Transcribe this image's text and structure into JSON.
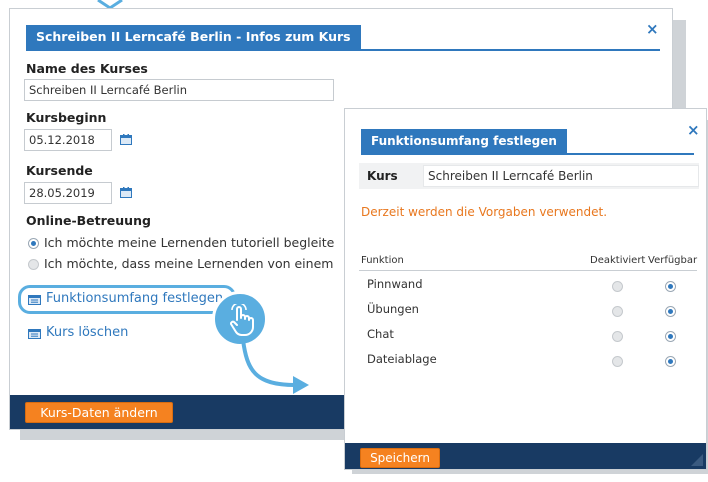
{
  "dialog1": {
    "title": "Schreiben II Lerncafé Berlin - Infos zum Kurs",
    "close_label": "×",
    "course_name_label": "Name des Kurses",
    "course_name_value": "Schreiben II Lerncafé Berlin",
    "start_label": "Kursbeginn",
    "start_value": "05.12.2018",
    "end_label": "Kursende",
    "end_value": "28.05.2019",
    "online_label": "Online-Betreuung",
    "options": [
      {
        "label": "Ich möchte meine Lernenden tutoriell begleite",
        "selected": true
      },
      {
        "label": "Ich möchte, dass meine Lernenden von einem",
        "selected": false
      }
    ],
    "function_link": "Funktionsumfang festlegen",
    "delete_link": "Kurs löschen",
    "submit_button": "Kurs-Daten ändern"
  },
  "dialog2": {
    "title": "Funktionsumfang festlegen",
    "close_label": "×",
    "course_label": "Kurs",
    "course_value": "Schreiben II Lerncafé Berlin",
    "notice": "Derzeit werden die Vorgaben verwendet.",
    "columns": [
      "Funktion",
      "Deaktiviert",
      "Verfügbar"
    ],
    "rows": [
      {
        "name": "Pinnwand",
        "value": "Verfügbar"
      },
      {
        "name": "Übungen",
        "value": "Verfügbar"
      },
      {
        "name": "Chat",
        "value": "Verfügbar"
      },
      {
        "name": "Dateiablage",
        "value": "Verfügbar"
      }
    ],
    "save_button": "Speichern"
  },
  "colors": {
    "accent": "#2f78bd",
    "footer": "#183a63",
    "button": "#f58220",
    "highlight": "#5aaee0",
    "notice": "#e8771e"
  },
  "icons": [
    "calendar-icon",
    "list-icon",
    "hand-pointer-icon",
    "close-icon",
    "resize-grip-icon"
  ]
}
